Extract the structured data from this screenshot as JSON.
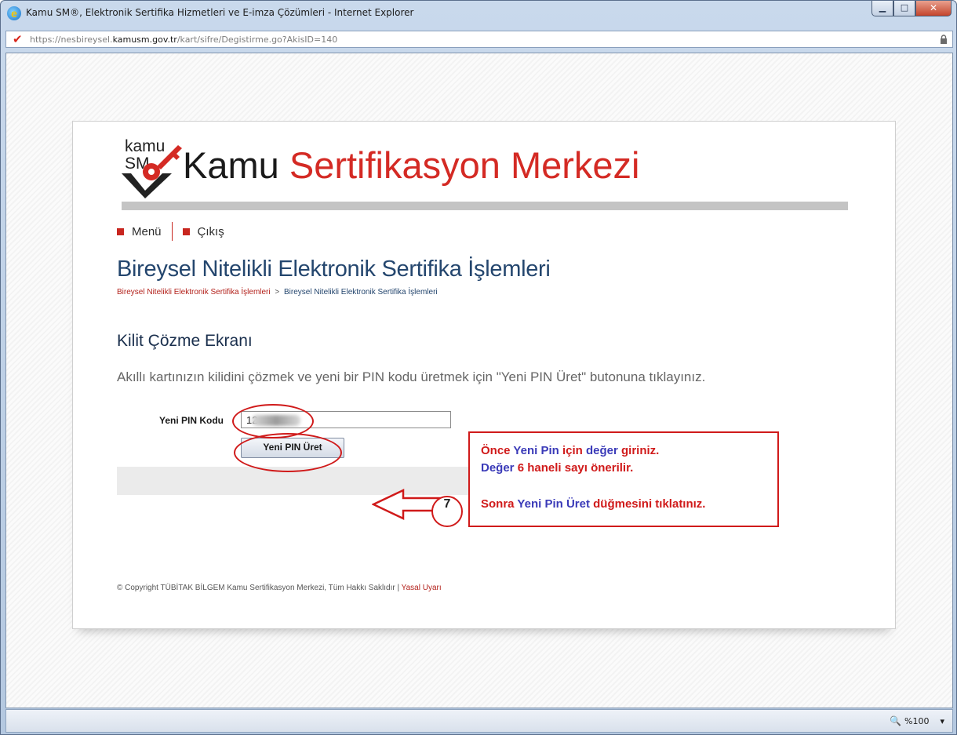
{
  "window": {
    "title": "Kamu SM®, Elektronik Sertifika Hizmetleri ve E-imza Çözümleri - Internet Explorer",
    "min_glyph": "▁",
    "max_glyph": "□",
    "close_glyph": "✕"
  },
  "address": {
    "scheme": "https://",
    "host_prefix": "nesbireysel.",
    "host_domain": "kamusm.gov.tr",
    "path": "/kart/sifre/Degistirme.go?AkisID=140"
  },
  "status": {
    "zoom": "%100",
    "zoom_arrow": "▾"
  },
  "logo": {
    "small_line1": "kamu",
    "small_line2": "SM",
    "word1": "Kamu",
    "word2": "Sertifikasyon Merkezi"
  },
  "nav": {
    "menu": "Menü",
    "logout": "Çıkış"
  },
  "page": {
    "heading": "Bireysel Nitelikli Elektronik Sertifika İşlemleri",
    "breadcrumb_link": "Bireysel Nitelikli Elektronik Sertifika İşlemleri",
    "breadcrumb_sep": ">",
    "breadcrumb_current": "Bireysel Nitelikli Elektronik Sertifika İşlemleri",
    "section_title": "Kilit Çözme Ekranı",
    "instruction": "Akıllı kartınızın kilidini çözmek ve yeni bir PIN kodu üretmek için \"Yeni PIN Üret\" butonuna tıklayınız."
  },
  "form": {
    "pin_label": "Yeni PIN Kodu",
    "pin_value": "12",
    "button_label": "Yeni PIN Üret"
  },
  "footer": {
    "copyright": "© Copyright TÜBİTAK BİLGEM Kamu Sertifikasyon Merkezi, Tüm Hakkı Saklıdır | ",
    "legal_link": "Yasal Uyarı"
  },
  "annotation": {
    "step_number": "7",
    "line1": [
      "Önce",
      "Yeni Pin",
      "için",
      "değer",
      "giriniz."
    ],
    "line2": [
      "Değer",
      "6",
      "haneli sayı önerilir."
    ],
    "line3": [
      "Sonra",
      "Yeni Pin Üret",
      "düğmesini tıklatınız."
    ],
    "color_red": "#d01a1a",
    "color_blue": "#3a3ab8"
  }
}
